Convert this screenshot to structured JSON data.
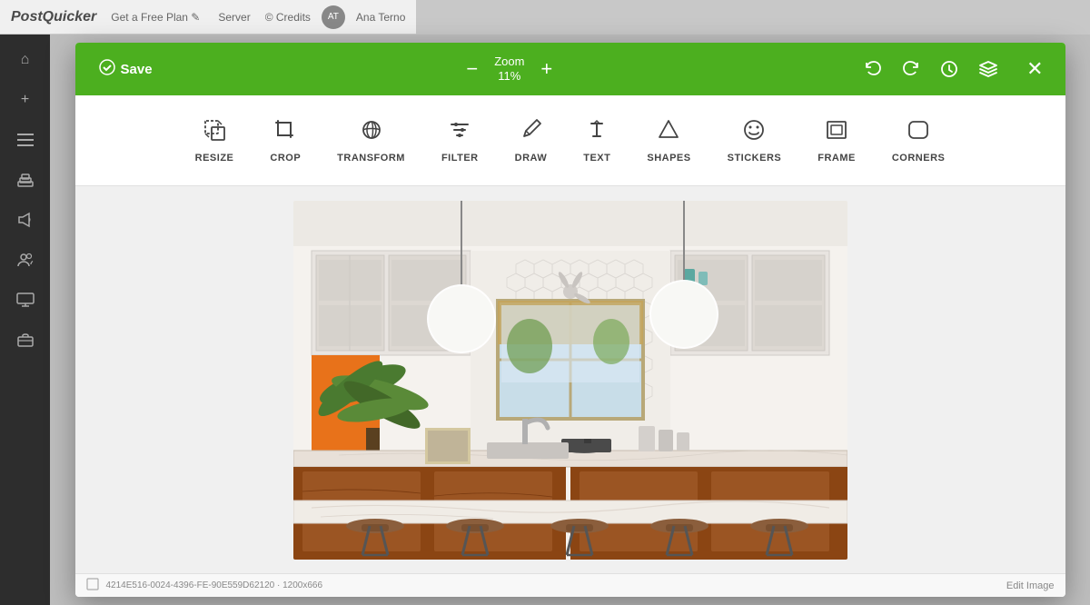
{
  "app": {
    "name": "PostQuicker",
    "topbar": {
      "links": [
        "Get a Free Plan ✎",
        "Server"
      ],
      "right_links": [
        "© Credits",
        "Ana Terno"
      ]
    }
  },
  "sidebar": {
    "items": [
      {
        "name": "home",
        "icon": "⌂"
      },
      {
        "name": "add",
        "icon": "+"
      },
      {
        "name": "list",
        "icon": "☰"
      },
      {
        "name": "layers",
        "icon": "❐"
      },
      {
        "name": "megaphone",
        "icon": "📢"
      },
      {
        "name": "users",
        "icon": "👥"
      },
      {
        "name": "monitor",
        "icon": "🖥"
      },
      {
        "name": "briefcase",
        "icon": "💼"
      }
    ]
  },
  "modal": {
    "header": {
      "save_label": "Save",
      "zoom_label": "Zoom",
      "zoom_value": "11%",
      "undo_label": "undo",
      "redo_label": "redo",
      "history_label": "history",
      "layers_label": "layers",
      "close_label": "close"
    },
    "toolbar": {
      "tools": [
        {
          "name": "resize",
          "label": "RESIZE",
          "icon": "resize"
        },
        {
          "name": "crop",
          "label": "CROP",
          "icon": "crop"
        },
        {
          "name": "transform",
          "label": "TRANSFORM",
          "icon": "transform"
        },
        {
          "name": "filter",
          "label": "FILTER",
          "icon": "filter"
        },
        {
          "name": "draw",
          "label": "DRAW",
          "icon": "draw"
        },
        {
          "name": "text",
          "label": "TEXT",
          "icon": "text"
        },
        {
          "name": "shapes",
          "label": "SHAPES",
          "icon": "shapes"
        },
        {
          "name": "stickers",
          "label": "STICKERS",
          "icon": "stickers"
        },
        {
          "name": "frame",
          "label": "FRAME",
          "icon": "frame"
        },
        {
          "name": "corners",
          "label": "CORNERS",
          "icon": "corners"
        }
      ]
    },
    "statusbar": {
      "coordinates": "4214E516-0024-4396-FE-90E559D62120 · 1200x666",
      "edit_image": "Edit Image"
    }
  },
  "colors": {
    "accent_green": "#4caf1f",
    "toolbar_bg": "#ffffff",
    "canvas_bg": "#f0f0f0",
    "sidebar_bg": "#2d2d2d"
  }
}
